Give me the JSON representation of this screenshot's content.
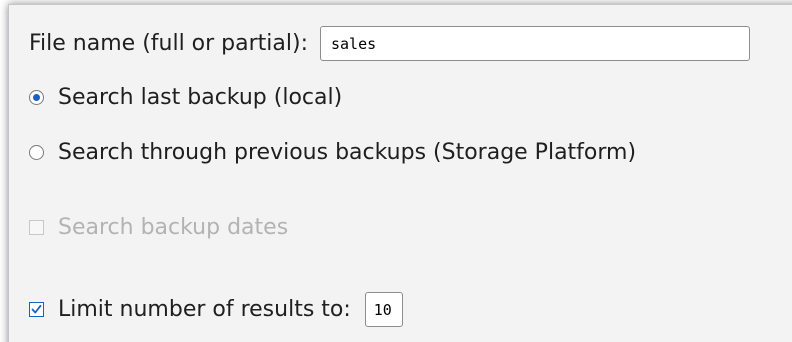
{
  "search_form": {
    "filename_label": "File name (full or partial):",
    "filename_value": "sales",
    "option_local": {
      "label": "Search last backup (local)",
      "selected": true
    },
    "option_previous": {
      "label": "Search through previous backups (Storage Platform)",
      "selected": false
    },
    "backup_dates": {
      "label": "Search backup dates",
      "checked": false,
      "enabled": false
    },
    "limit_results": {
      "label": "Limit number of results to:",
      "checked": true,
      "value": "10"
    }
  },
  "colors": {
    "accent": "#1a5fc4",
    "panel_background": "#f3f3f4",
    "disabled_text": "#b3b3b3"
  }
}
